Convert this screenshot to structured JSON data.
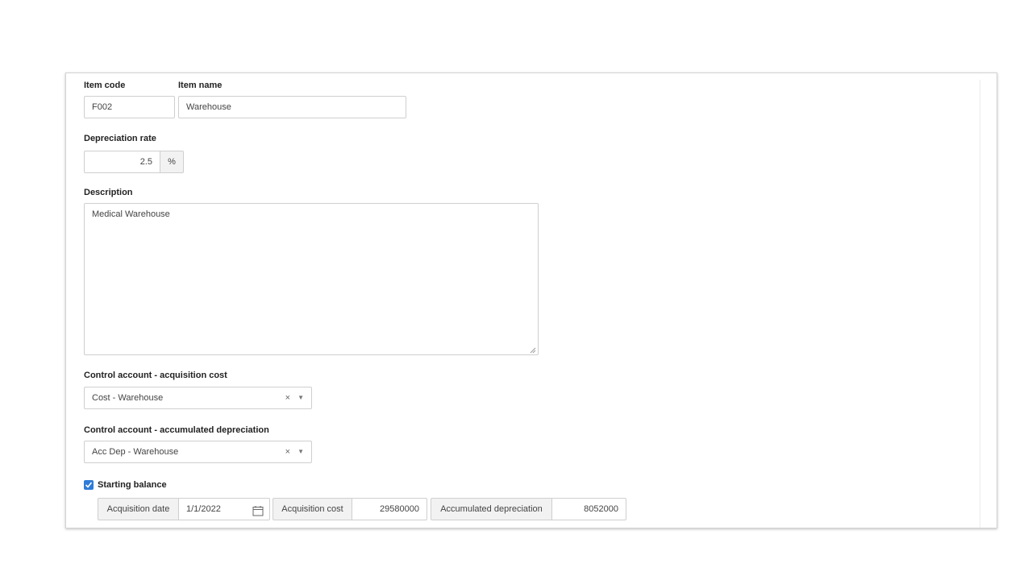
{
  "form": {
    "item_code": {
      "label": "Item code",
      "value": "F002"
    },
    "item_name": {
      "label": "Item name",
      "value": "Warehouse"
    },
    "depreciation_rate": {
      "label": "Depreciation rate",
      "value": "2.5",
      "unit": "%"
    },
    "description": {
      "label": "Description",
      "value": "Medical Warehouse"
    },
    "control_account_acquisition": {
      "label": "Control account - acquisition cost",
      "value": "Cost - Warehouse",
      "clear_glyph": "×",
      "arrow_glyph": "▼"
    },
    "control_account_depreciation": {
      "label": "Control account - accumulated depreciation",
      "value": "Acc Dep - Warehouse",
      "clear_glyph": "×",
      "arrow_glyph": "▼"
    },
    "starting_balance": {
      "label": "Starting balance",
      "checked": true,
      "acquisition_date_label": "Acquisition date",
      "acquisition_date_value": "1/1/2022",
      "acquisition_cost_label": "Acquisition cost",
      "acquisition_cost_value": "29580000",
      "accumulated_depreciation_label": "Accumulated depreciation",
      "accumulated_depreciation_value": "8052000"
    }
  },
  "icons": {
    "calendar": "calendar-icon",
    "checkbox": "check-icon",
    "resize": "resize-grip-icon"
  },
  "colors": {
    "checkbox": "#2f7bd8",
    "border": "#cfcfcf",
    "addon_bg": "#f2f2f2"
  }
}
